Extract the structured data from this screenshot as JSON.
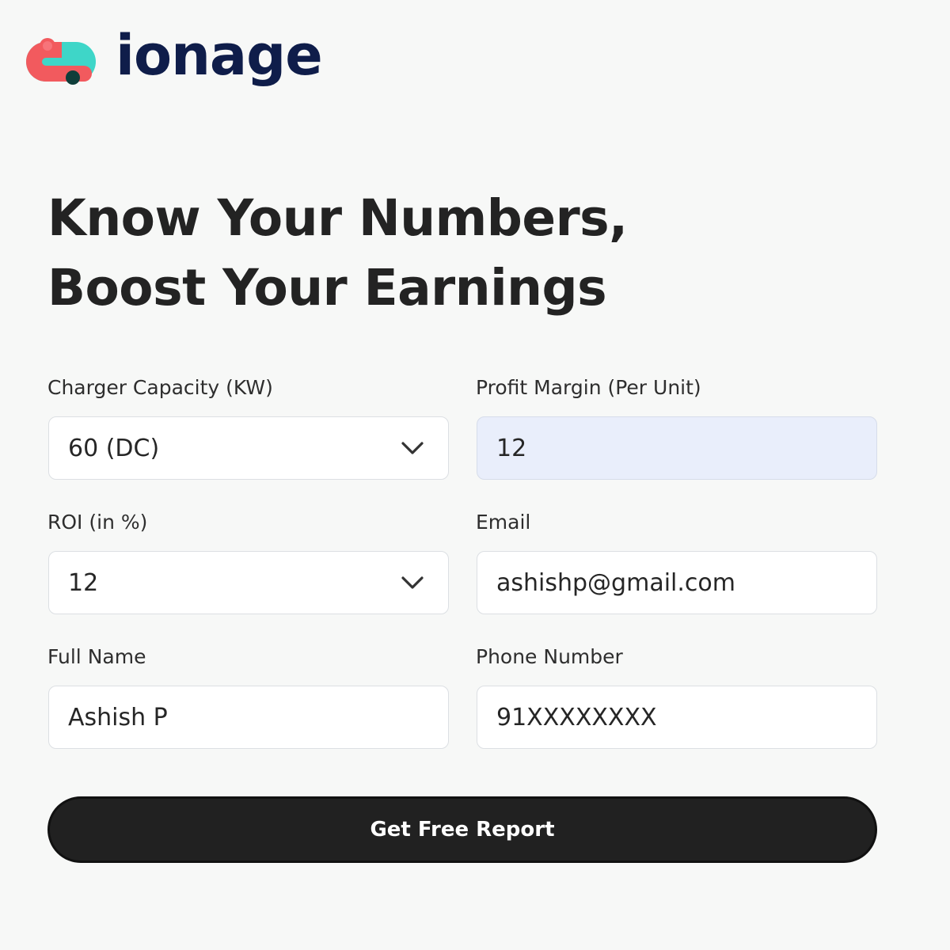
{
  "brand": {
    "name": "ionage",
    "colors": {
      "coral": "#f25a5e",
      "teal": "#3ed6c8",
      "dark_teal": "#0f3e3a",
      "navy": "#0f1d4a"
    }
  },
  "headline": "Know Your Numbers, Boost Your Earnings",
  "form": {
    "charger_capacity": {
      "label": "Charger Capacity (KW)",
      "value": "60 (DC)"
    },
    "profit_margin": {
      "label": "Profit Margin (Per Unit)",
      "value": "12"
    },
    "roi": {
      "label": "ROI (in %)",
      "value": "12"
    },
    "email": {
      "label": "Email",
      "value": "ashishp@gmail.com"
    },
    "full_name": {
      "label": "Full Name",
      "value": "Ashish P"
    },
    "phone": {
      "label": "Phone Number",
      "value": "91XXXXXXXX"
    },
    "submit_label": "Get Free Report"
  },
  "colors": {
    "background": "#f7f8f7",
    "text": "#222222",
    "input_background": "#ffffff",
    "autofill_background": "#e9eefb",
    "button_background": "#212121",
    "button_text": "#ffffff"
  }
}
